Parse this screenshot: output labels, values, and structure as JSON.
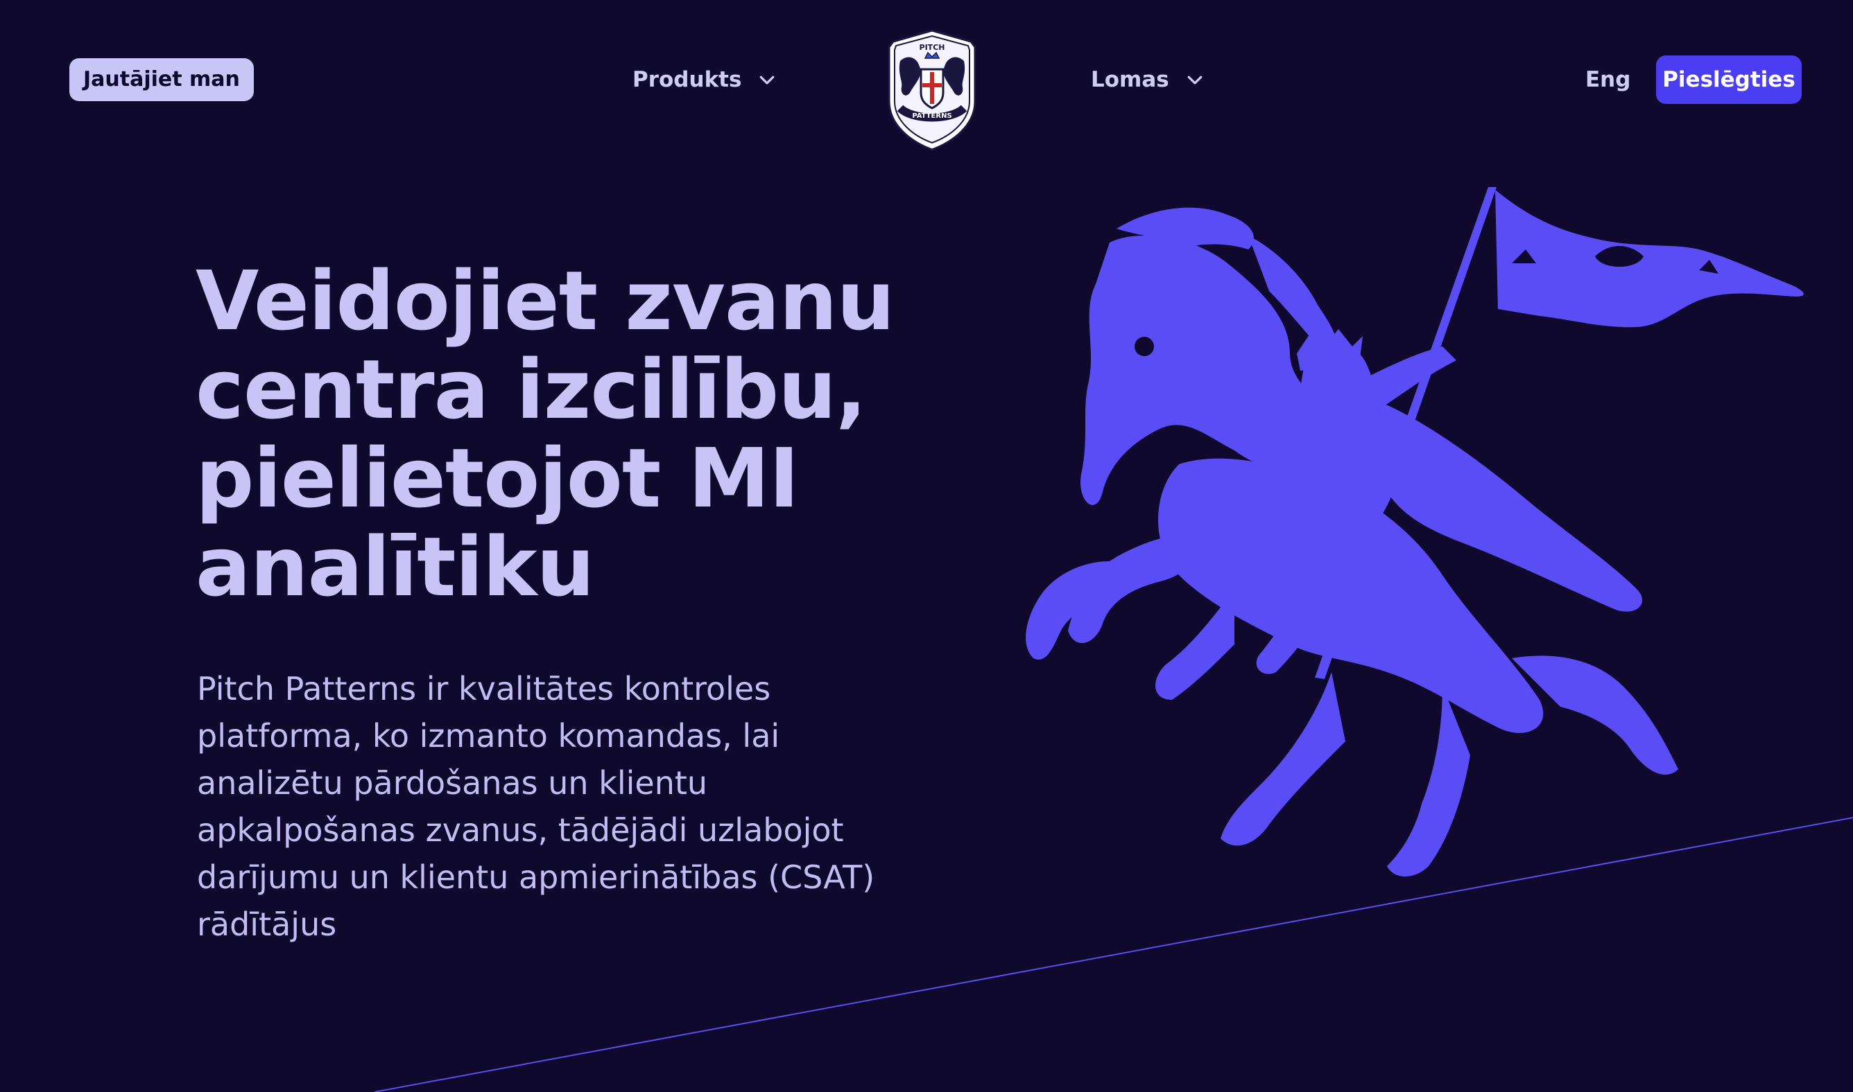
{
  "header": {
    "ask_label": "Jautājiet man",
    "nav": [
      {
        "label": "Produkts"
      },
      {
        "label": "Lomas"
      }
    ],
    "logo_text_top": "PITCH",
    "logo_text_bottom": "PATTERNS",
    "lang_label": "Eng",
    "login_label": "Pieslēgties"
  },
  "hero": {
    "title_lines": [
      "Veidojiet zvanu",
      "centra izcilību,",
      "pielietojot MI",
      "analītiku"
    ],
    "description": "Pitch Patterns ir kvalitātes kontroles platforma, ko izmanto komandas, lai analizētu pārdošanas un klientu apkalpošanas zvanus, tādējādi uzlabojot darījumu un klientu apmierinātības (CSAT) rādītājus"
  },
  "colors": {
    "background": "#0f0a2d",
    "accent": "#4a3df2",
    "illustration": "#5a4df5",
    "text_light": "#c9c4f5"
  },
  "icons": {
    "chevron": "chevron-down-icon",
    "logo": "crest-logo-icon",
    "illustration": "knight-on-horse-illustration"
  }
}
